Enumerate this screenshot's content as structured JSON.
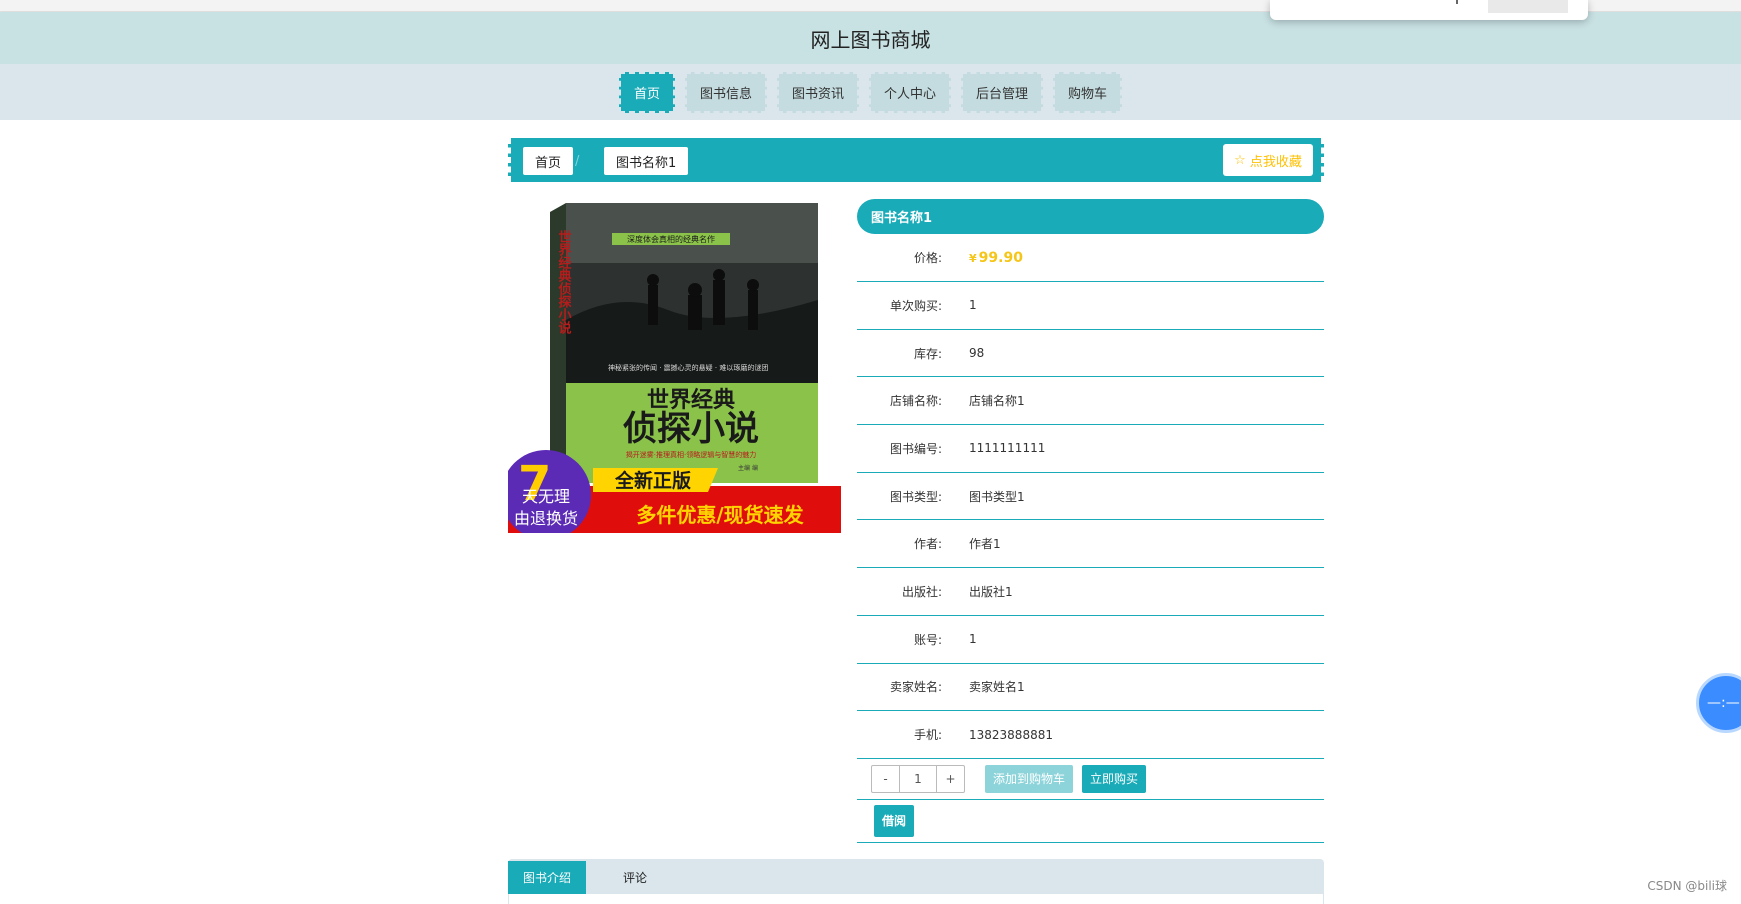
{
  "site": {
    "title": "网上图书商城"
  },
  "nav": {
    "items": [
      {
        "label": "首页",
        "active": true
      },
      {
        "label": "图书信息",
        "active": false
      },
      {
        "label": "图书资讯",
        "active": false
      },
      {
        "label": "个人中心",
        "active": false
      },
      {
        "label": "后台管理",
        "active": false
      },
      {
        "label": "购物车",
        "active": false
      }
    ]
  },
  "breadcrumb": {
    "home": "首页",
    "separator": "/",
    "current": "图书名称1"
  },
  "collect": {
    "icon": "star-outline-icon",
    "label": "点我收藏"
  },
  "cover": {
    "top_banner": "深度体会真相的经典名作",
    "vertical_title": "世界经典侦探小说",
    "tagline": "神秘紧张的传闻 · 震撼心灵的悬疑 · 难以琢磨的谜团",
    "main_title_1": "世界经典",
    "main_title_2": "侦探小说",
    "subline": "揭开迷雾·推理真相·领略逻辑与智慧的魅力",
    "editor": "主编 编",
    "badge_num": "7",
    "badge_1": "天无理",
    "badge_2": "由退换货",
    "promo_1": "全新正版",
    "promo_2": "多件优惠/现货速发"
  },
  "product": {
    "name": "图书名称1",
    "price_label": "价格:",
    "currency": "¥",
    "price": "99.90",
    "fields": [
      {
        "label": "单次购买:",
        "value": "1"
      },
      {
        "label": "库存:",
        "value": "98"
      },
      {
        "label": "店铺名称:",
        "value": "店铺名称1"
      },
      {
        "label": "图书编号:",
        "value": "1111111111"
      },
      {
        "label": "图书类型:",
        "value": "图书类型1"
      },
      {
        "label": "作者:",
        "value": "作者1"
      },
      {
        "label": "出版社:",
        "value": "出版社1"
      },
      {
        "label": "账号:",
        "value": "1"
      },
      {
        "label": "卖家姓名:",
        "value": "卖家姓名1"
      },
      {
        "label": "手机:",
        "value": "13823888881"
      }
    ]
  },
  "purchase": {
    "minus": "-",
    "quantity": "1",
    "plus": "+",
    "add_to_cart": "添加到购物车",
    "buy_now": "立即购买",
    "borrow": "借阅"
  },
  "tabs": [
    {
      "label": "图书介绍",
      "active": true
    },
    {
      "label": "评论",
      "active": false
    }
  ],
  "float_ball": {
    "label": "—:—"
  },
  "watermark": "CSDN @bili球",
  "colors": {
    "accent": "#1aabb8",
    "header_bg": "#c8e1e3",
    "nav_bg": "#dae6ec",
    "price": "#f5c518"
  }
}
